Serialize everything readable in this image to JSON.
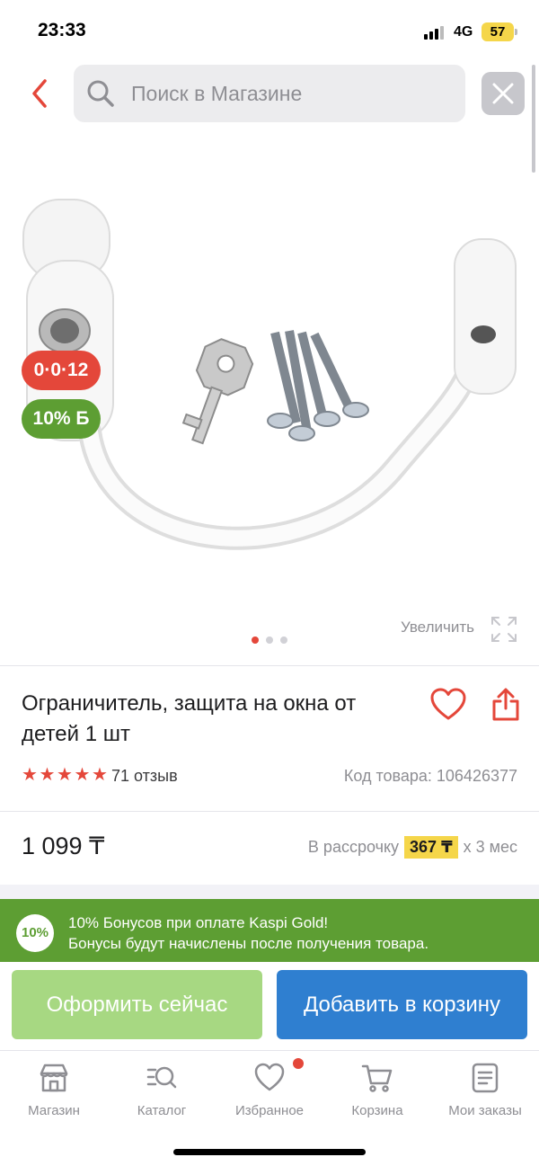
{
  "status_bar": {
    "time": "23:33",
    "network": "4G",
    "battery": "57"
  },
  "search": {
    "placeholder": "Поиск в Магазине"
  },
  "product": {
    "badge_timer": "0·0·12",
    "badge_bonus": "10% Б",
    "zoom_label": "Увеличить",
    "gallery_total": 3,
    "gallery_active": 1,
    "title": "Ограничитель, защита на окна от детей 1 шт",
    "rating_stars": 5,
    "reviews": "71 отзыв",
    "code": "Код товара: 106426377",
    "price": "1 099 ₸",
    "installment_prefix": "В рассрочку",
    "installment_amount": "367 ₸",
    "installment_suffix": "x 3 мес"
  },
  "promo": {
    "badge": "10%",
    "line1": "10% Бонусов при оплате Kaspi Gold!",
    "line2": "Бонусы будут начислены после получения товара."
  },
  "actions": {
    "buy_now": "Оформить сейчас",
    "add_to_cart": "Добавить в корзину"
  },
  "tabbar": {
    "items": [
      {
        "label": "Магазин",
        "icon": "store-icon"
      },
      {
        "label": "Каталог",
        "icon": "catalog-icon"
      },
      {
        "label": "Избранное",
        "icon": "heart-icon"
      },
      {
        "label": "Корзина",
        "icon": "cart-icon"
      },
      {
        "label": "Мои заказы",
        "icon": "orders-icon"
      }
    ]
  },
  "colors": {
    "accent_red": "#e4473a",
    "bonus_green": "#5d9e33",
    "buy_button": "#a7d882",
    "cart_button": "#2f7fd0",
    "installment_highlight": "#f5d64a"
  }
}
